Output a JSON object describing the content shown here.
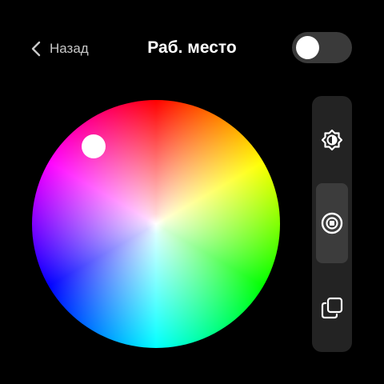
{
  "header": {
    "back_label": "Назад",
    "title": "Раб. место",
    "toggle_on": false
  },
  "color_wheel": {
    "selected_color": "#ff33ff"
  },
  "side_panel": {
    "modes": [
      {
        "icon": "brightness-icon",
        "active": false
      },
      {
        "icon": "color-temperature-icon",
        "active": true
      },
      {
        "icon": "scenes-icon",
        "active": false
      }
    ]
  },
  "colors": {
    "background": "#000000",
    "panel": "#232323",
    "active_mode": "#3c3c3c",
    "toggle_track": "#3a3a3a",
    "text_secondary": "#c8c8c8"
  }
}
